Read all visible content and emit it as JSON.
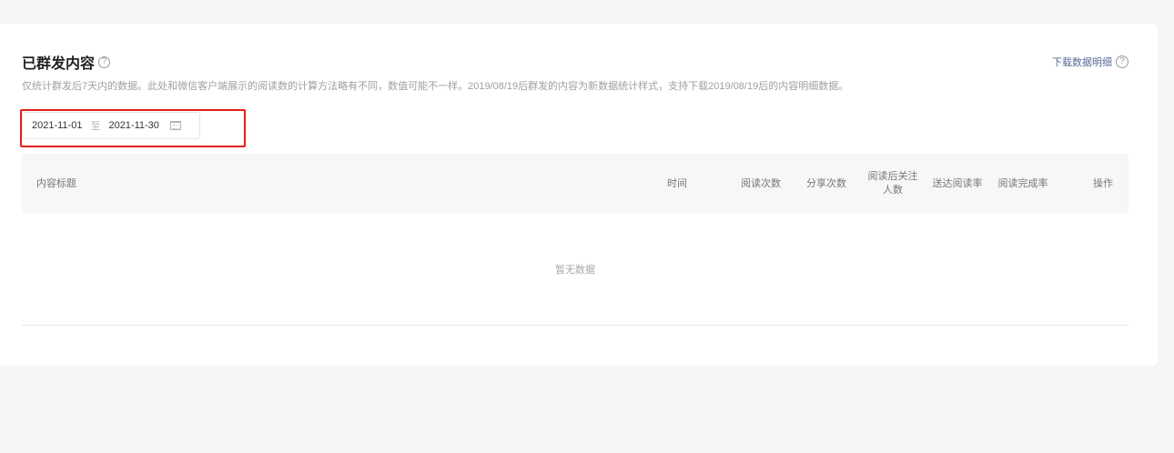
{
  "section": {
    "title": "已群发内容",
    "help_icon": "?",
    "subtitle": "仅统计群发后7天内的数据。此处和微信客户端展示的阅读数的计算方法略有不同，数值可能不一样。2019/08/19后群发的内容为新数据统计样式，支持下载2019/08/19后的内容明细数据。",
    "download_label": "下载数据明细"
  },
  "date_range": {
    "start": "2021-11-01",
    "separator": "至",
    "end": "2021-11-30",
    "icon": "calendar-icon"
  },
  "table": {
    "columns": {
      "title": "内容标题",
      "time": "时间",
      "reads": "阅读次数",
      "shares": "分享次数",
      "follows_line1": "阅读后关注",
      "follows_line2": "人数",
      "delivery_read_rate": "送达阅读率",
      "completion_rate": "阅读完成率",
      "actions": "操作"
    },
    "empty_text": "暂无数据"
  },
  "colors": {
    "highlight": "#e0201c",
    "link": "#576b95"
  }
}
